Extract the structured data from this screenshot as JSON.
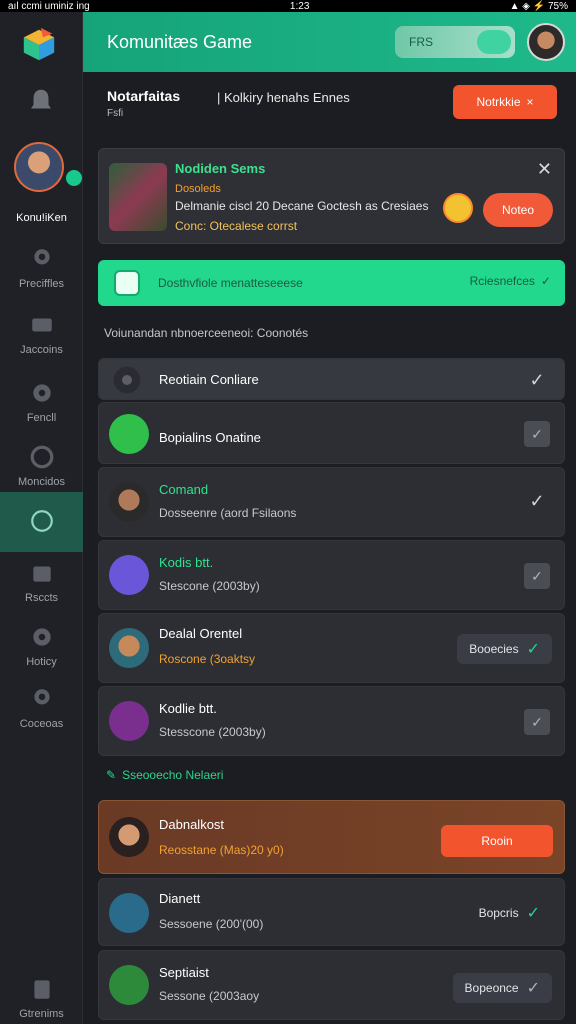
{
  "statusbar": {
    "left": "aıl ccmi uminiz ing",
    "center": "1:23",
    "right": "▲ ◈ ⚡ 75%"
  },
  "sidebar": {
    "user_name": "Konu!iKen",
    "items": [
      {
        "label": "Preciffles",
        "icon": "pin-icon"
      },
      {
        "label": "Jaccoins",
        "icon": "store-icon"
      },
      {
        "label": "Fencll",
        "icon": "gear-icon"
      },
      {
        "label": "Moncidos",
        "icon": "smiley-icon"
      },
      {
        "label": "",
        "icon": "chat-icon"
      },
      {
        "label": "Rsccts",
        "icon": "bag-icon"
      },
      {
        "label": "Hoticy",
        "icon": "gear-icon"
      },
      {
        "label": "Coceoas",
        "icon": "pin-icon"
      },
      {
        "label": "Gtrenims",
        "icon": "clipboard-icon"
      }
    ]
  },
  "topbar": {
    "title": "Komunitæs Game",
    "pill_label": "FRS"
  },
  "notice": {
    "title": "Notarfaitas",
    "text": "| Kolkiry henahs Ennes",
    "sub": "Fsfi",
    "button": "Notrkkie"
  },
  "card": {
    "title": "Nodiden Sems",
    "tag": "Dosoleds",
    "text": "Delmanie ciscl 20 Decane Goctesh as Cresiaes",
    "sub": "Conc: Otecalese corrst",
    "button": "Noteo"
  },
  "banner": {
    "text": "Dosthvfiole menatteseeese",
    "right": "Rciesnefces"
  },
  "section_header": "Voiunandan nbnoerceeneoi: Coonotés",
  "rows": [
    {
      "name": "Reotiain Conliare",
      "sub": "",
      "name_color": "#ffffff",
      "sub_color": "#c8c9cc",
      "action": "check-plain"
    },
    {
      "name": "Bopialins Onatine",
      "sub": "",
      "name_color": "#ffffff",
      "sub_color": "#c8c9cc",
      "action": "check-box"
    },
    {
      "name": "Comand",
      "sub": "Dosseenre (aord Fsilaons",
      "name_color": "#2ee28e",
      "sub_color": "#c8c9cc",
      "action": "check-plain"
    },
    {
      "name": "Kodis btt.",
      "sub": "Stescone (2003by)",
      "name_color": "#2ee28e",
      "sub_color": "#c8c9cc",
      "action": "check-box"
    },
    {
      "name": "Dealal Orentel",
      "sub": "Roscone (3oaktsy",
      "name_color": "#ffffff",
      "sub_color": "#f1a233",
      "action": "button",
      "button": "Booecies"
    },
    {
      "name": "Kodlie btt.",
      "sub": "Stesscone (2003by)",
      "name_color": "#ffffff",
      "sub_color": "#c8c9cc",
      "action": "check-box"
    }
  ],
  "sub_header": "Sseooecho Nelaeri",
  "list2": [
    {
      "name": "Dabnalkost",
      "sub": "Reosstane (Mas)20 y0)",
      "button": "Rooin"
    },
    {
      "name": "Dianett",
      "sub": "Sessoene (200'(00)",
      "button": "Bopcris"
    },
    {
      "name": "Septiaist",
      "sub": "Sessone (2003aoy",
      "button": "Bopeonce"
    }
  ],
  "colors": {
    "accent": "#1eb98a",
    "orange": "#f2542d",
    "bg": "#1c1d22",
    "card": "#2c2e34"
  }
}
